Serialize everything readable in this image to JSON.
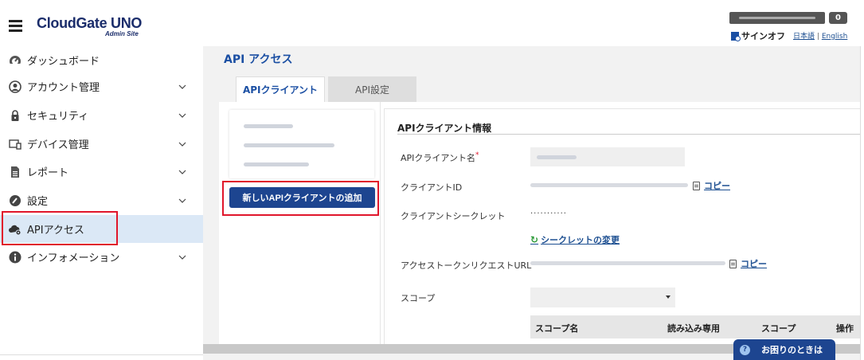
{
  "header": {
    "logo_main": "CloudGate UNO",
    "logo_sub": "Admin Site",
    "notification_count": "0",
    "signoff_label": "サインオフ",
    "lang_ja": "日本語",
    "lang_sep": "|",
    "lang_en": "English"
  },
  "sidebar": {
    "items": [
      {
        "label": "ダッシュボード",
        "icon": "dashboard-icon"
      },
      {
        "label": "アカウント管理",
        "icon": "user-icon"
      },
      {
        "label": "セキュリティ",
        "icon": "lock-icon"
      },
      {
        "label": "デバイス管理",
        "icon": "device-icon"
      },
      {
        "label": "レポート",
        "icon": "report-icon"
      },
      {
        "label": "設定",
        "icon": "settings-icon"
      },
      {
        "label": "APIアクセス",
        "icon": "cloud-icon"
      },
      {
        "label": "インフォメーション",
        "icon": "info-icon"
      }
    ],
    "active_index": 6
  },
  "main": {
    "title": "API アクセス",
    "tabs": [
      {
        "label": "APIクライアント",
        "active": true
      },
      {
        "label": "API設定",
        "active": false
      }
    ],
    "add_button_label": "新しいAPIクライアントの追加",
    "detail": {
      "title": "APIクライアント情報",
      "client_name_label": "APIクライアント名",
      "required_mark": "*",
      "client_id_label": "クライアントID",
      "copy_label": "コピー",
      "client_secret_label": "クライアントシークレット",
      "secret_masked": "···········",
      "secret_change_label": "シークレットの変更",
      "token_url_label": "アクセストークンリクエストURL",
      "scope_label": "スコープ",
      "scope_table": {
        "columns": [
          "スコープ名",
          "読み込み専用",
          "スコープ",
          "操作"
        ]
      }
    }
  },
  "help_button_label": "お困りのときは",
  "colors": {
    "accent": "#1d4590",
    "title_blue": "#1b4fa3",
    "highlight_red": "#e0162b",
    "active_nav_bg": "#dbe8f6"
  }
}
